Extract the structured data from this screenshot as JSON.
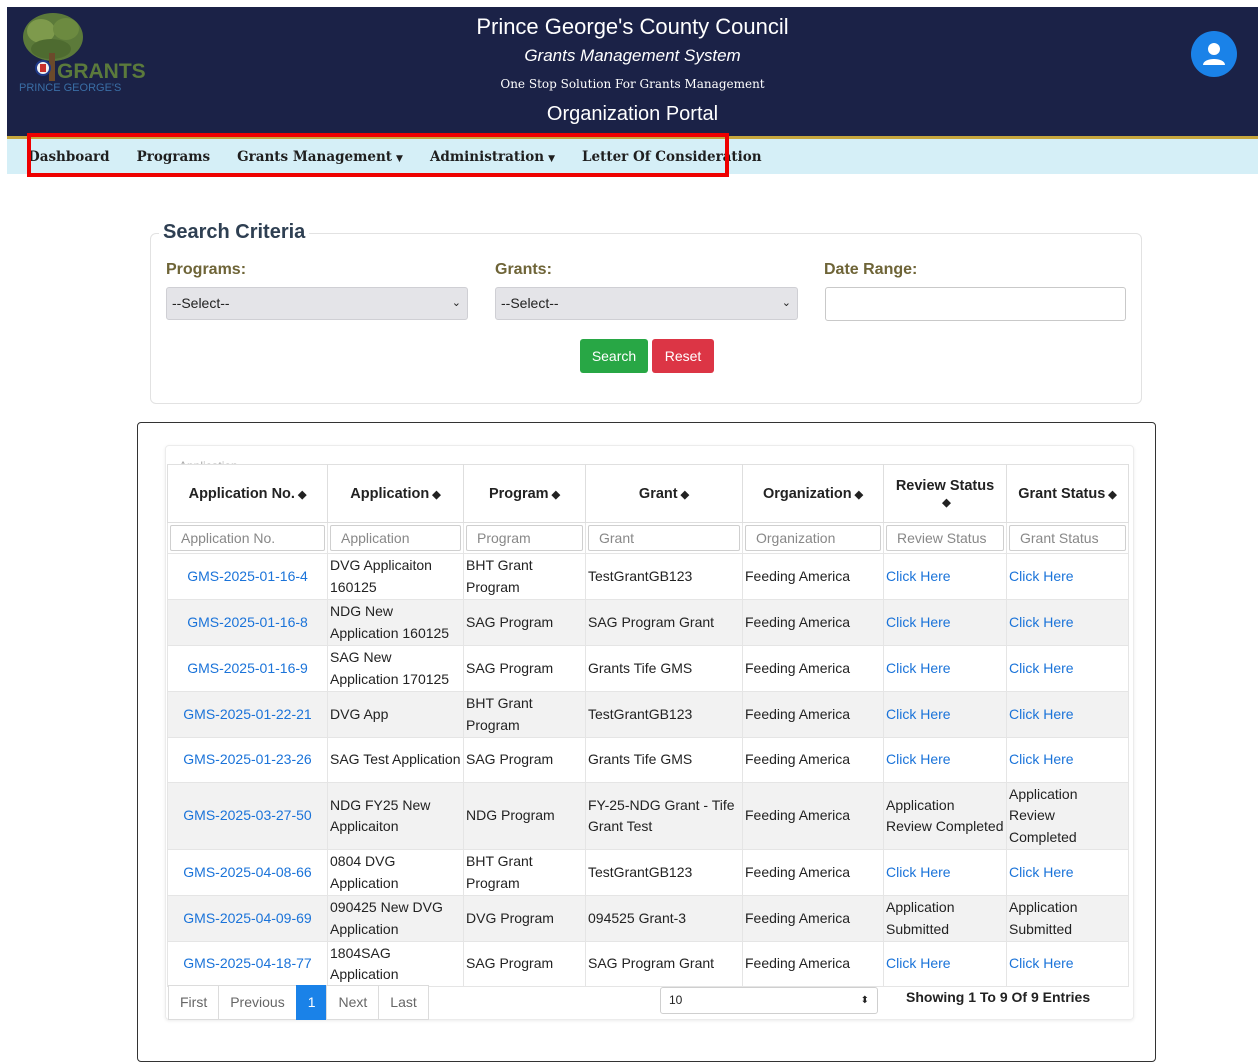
{
  "header": {
    "title": "Prince George's County Council",
    "subtitle": "Grants Management System",
    "tagline": "One Stop Solution For Grants Management",
    "portal": "Organization Portal",
    "logo_text": "GRANTS",
    "logo_subtext": "PRINCE GEORGE'S",
    "icons": {
      "avatar": "user-avatar-icon"
    },
    "colors": {
      "background": "#1b2247",
      "accent": "#c7a73d",
      "avatar": "#1a82e8"
    }
  },
  "nav": {
    "items": [
      {
        "label": "Dashboard",
        "dropdown": false
      },
      {
        "label": "Programs",
        "dropdown": false
      },
      {
        "label": "Grants Management",
        "dropdown": true
      },
      {
        "label": "Administration",
        "dropdown": true
      },
      {
        "label": "Letter Of Consideration",
        "dropdown": false
      }
    ]
  },
  "search": {
    "legend": "Search Criteria",
    "programs_label": "Programs:",
    "programs_value": "--Select--",
    "grants_label": "Grants:",
    "grants_value": "--Select--",
    "date_label": "Date Range:",
    "date_value": "",
    "search_button": "Search",
    "reset_button": "Reset",
    "colors": {
      "search": "#28a745",
      "reset": "#dc3545"
    }
  },
  "table": {
    "legend": "Application",
    "columns": [
      "Application No.",
      "Application",
      "Program",
      "Grant",
      "Organization",
      "Review Status",
      "Grant Status"
    ],
    "filters": [
      "Application No.",
      "Application",
      "Program",
      "Grant",
      "Organization",
      "Review Status",
      "Grant Status"
    ],
    "rows": [
      {
        "app_no": "GMS-2025-01-16-4",
        "application": "DVG Applicaiton 160125",
        "program": "BHT Grant Program",
        "grant": "TestGrantGB123",
        "organization": "Feeding America",
        "review_status": "Click Here",
        "review_link": true,
        "grant_status": "Click Here",
        "grant_link": true
      },
      {
        "app_no": "GMS-2025-01-16-8",
        "application": "NDG New Application 160125",
        "program": "SAG Program",
        "grant": "SAG Program Grant",
        "organization": "Feeding America",
        "review_status": "Click Here",
        "review_link": true,
        "grant_status": "Click Here",
        "grant_link": true
      },
      {
        "app_no": "GMS-2025-01-16-9",
        "application": "SAG New Application 170125",
        "program": "SAG Program",
        "grant": "Grants Tife GMS",
        "organization": "Feeding America",
        "review_status": "Click Here",
        "review_link": true,
        "grant_status": "Click Here",
        "grant_link": true
      },
      {
        "app_no": "GMS-2025-01-22-21",
        "application": "DVG App",
        "program": "BHT Grant Program",
        "grant": "TestGrantGB123",
        "organization": "Feeding America",
        "review_status": "Click Here",
        "review_link": true,
        "grant_status": "Click Here",
        "grant_link": true
      },
      {
        "app_no": "GMS-2025-01-23-26",
        "application": "SAG Test Application",
        "program": "SAG Program",
        "grant": "Grants Tife GMS",
        "organization": "Feeding America",
        "review_status": "Click Here",
        "review_link": true,
        "grant_status": "Click Here",
        "grant_link": true
      },
      {
        "app_no": "GMS-2025-03-27-50",
        "application": "NDG FY25 New Applicaiton",
        "program": "NDG Program",
        "grant": "FY-25-NDG Grant - Tife Grant Test",
        "organization": "Feeding America",
        "review_status": "Application Review Completed",
        "review_link": false,
        "grant_status": "Application Review Completed",
        "grant_link": false
      },
      {
        "app_no": "GMS-2025-04-08-66",
        "application": "0804 DVG Application",
        "program": "BHT Grant Program",
        "grant": "TestGrantGB123",
        "organization": "Feeding America",
        "review_status": "Click Here",
        "review_link": true,
        "grant_status": "Click Here",
        "grant_link": true
      },
      {
        "app_no": "GMS-2025-04-09-69",
        "application": "090425 New DVG Application",
        "program": "DVG Program",
        "grant": "094525 Grant-3",
        "organization": "Feeding America",
        "review_status": "Application Submitted",
        "review_link": false,
        "grant_status": "Application Submitted",
        "grant_link": false
      },
      {
        "app_no": "GMS-2025-04-18-77",
        "application": "1804SAG Application",
        "program": "SAG Program",
        "grant": "SAG Program Grant",
        "organization": "Feeding America",
        "review_status": "Click Here",
        "review_link": true,
        "grant_status": "Click Here",
        "grant_link": true
      }
    ]
  },
  "pagination": {
    "first": "First",
    "previous": "Previous",
    "current": "1",
    "next": "Next",
    "last": "Last",
    "page_size": "10",
    "showing": "Showing 1 To 9 Of 9 Entries"
  }
}
